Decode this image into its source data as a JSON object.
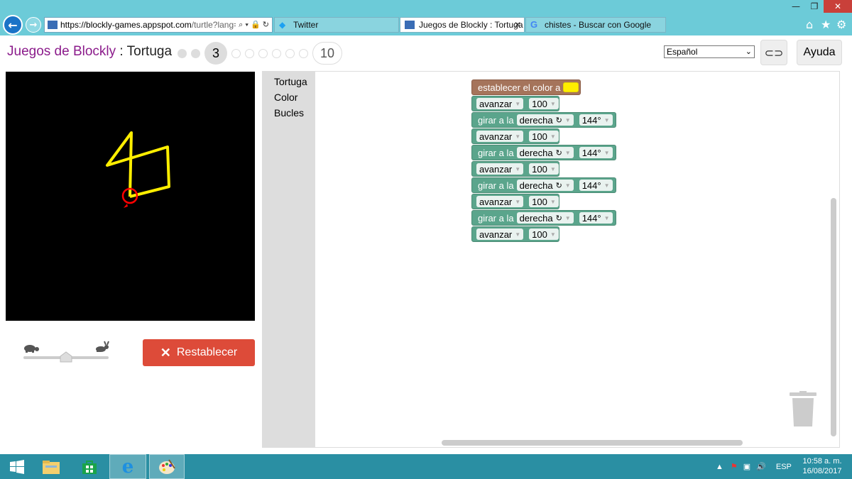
{
  "browser": {
    "url_host": "https://blockly-games.appspot.com",
    "url_rest": "/turtle?lang=es",
    "tabs": [
      {
        "label": "Twitter"
      },
      {
        "label": "Juegos de Blockly : Tortuga"
      },
      {
        "label": "chistes - Buscar con Google"
      }
    ]
  },
  "header": {
    "brand": "Juegos de Blockly",
    "separator": " : ",
    "title": "Tortuga",
    "current_level": "3",
    "last_level": "10",
    "language": "Español",
    "help_label": "Ayuda"
  },
  "toolbox": [
    "Tortuga",
    "Color",
    "Bucles"
  ],
  "blocks": {
    "set_color_label": "establecer el color a",
    "color_value": "#ffee00",
    "forward_label": "avanzar",
    "forward_value": "100",
    "turn_label": "girar a la",
    "turn_dir": "derecha",
    "turn_angle": "144°"
  },
  "controls": {
    "reset_label": "Restablecer"
  },
  "drawing": {
    "pen_color": "#ffee00",
    "turtle_color": "#ff0000"
  },
  "taskbar": {
    "language": "ESP",
    "time": "10:58 a. m.",
    "date": "16/08/2017"
  }
}
